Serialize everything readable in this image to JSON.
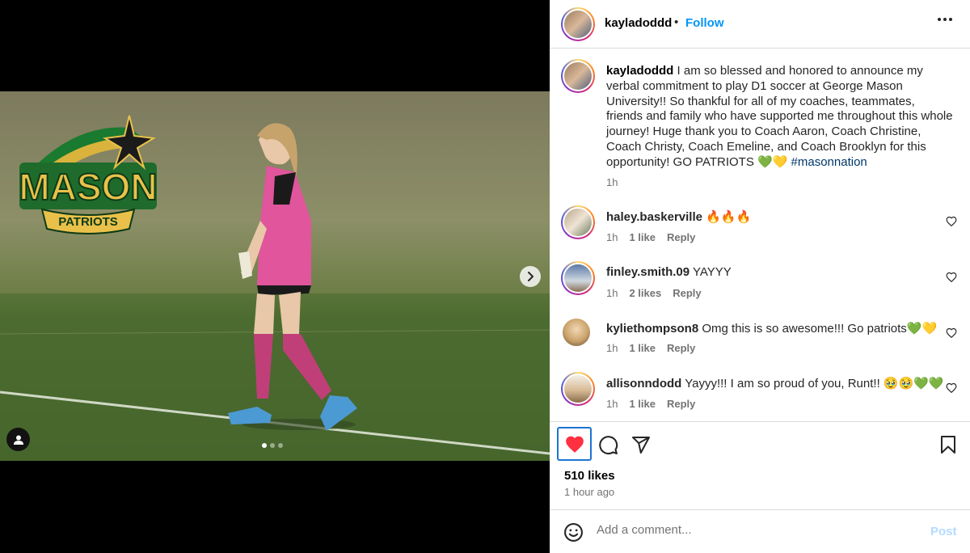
{
  "post": {
    "author": "kayladoddd",
    "follow_label": "Follow",
    "separator": "•",
    "more_icon": "more-horizontal-icon"
  },
  "media": {
    "logo_text": "MASON",
    "logo_subtext": "PATRIOTS",
    "slide_count": 3,
    "active_slide": 1
  },
  "caption": {
    "username": "kayladoddd",
    "text": "I am so blessed and honored to announce my verbal commitment to play D1 soccer at George Mason University!! So thankful for all of my coaches, teammates, friends and family who have supported me throughout this whole journey! Huge thank you to Coach Aaron, Coach Christine, Coach Christy, Coach Emeline, and Coach Brooklyn for this opportunity! GO PATRIOTS 💚💛 ",
    "hashtag": "#masonnation",
    "time": "1h"
  },
  "comments": [
    {
      "username": "haley.baskerville",
      "text": "🔥🔥🔥",
      "time": "1h",
      "likes": "1 like",
      "reply": "Reply"
    },
    {
      "username": "finley.smith.09",
      "text": "YAYYY",
      "time": "1h",
      "likes": "2 likes",
      "reply": "Reply"
    },
    {
      "username": "kyliethompson8",
      "text": "Omg this is so awesome!!! Go patriots💚💛",
      "time": "1h",
      "likes": "1 like",
      "reply": "Reply"
    },
    {
      "username": "allisonndodd",
      "text": "Yayyy!!! I am so proud of you, Runt!! 🥹🥹💚💚",
      "time": "1h",
      "likes": "1 like",
      "reply": "Reply"
    }
  ],
  "actions": {
    "likes_count": "510 likes",
    "time_ago": "1 hour ago",
    "liked": true,
    "accent_red": "#ff3040",
    "link_blue": "#0095f6"
  },
  "add_comment": {
    "placeholder": "Add a comment...",
    "post_label": "Post"
  }
}
